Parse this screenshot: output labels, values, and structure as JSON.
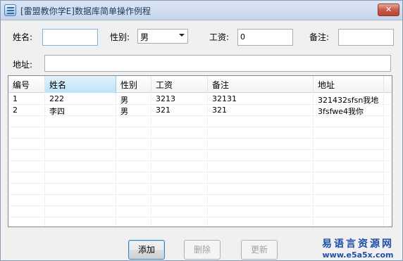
{
  "window": {
    "title": "[雷盟教你学E]数据库简单操作例程",
    "close_glyph": "✕"
  },
  "form": {
    "name_label": "姓名:",
    "name_value": "",
    "gender_label": "性别:",
    "gender_value": "男",
    "salary_label": "工资:",
    "salary_value": "0",
    "note_label": "备注:",
    "note_value": "",
    "address_label": "地址:",
    "address_value": ""
  },
  "table": {
    "columns": [
      "编号",
      "姓名",
      "性别",
      "工资",
      "备注",
      "地址"
    ],
    "rows": [
      [
        "1",
        "222",
        "男",
        "3213",
        "32131",
        "321432sfsn我地"
      ],
      [
        "2",
        "李四",
        "男",
        "321",
        "321",
        "3fsfwe4我你"
      ]
    ]
  },
  "buttons": {
    "add": "添加",
    "delete": "删除",
    "update": "更新"
  },
  "watermark": {
    "name": "易语言资源网",
    "url": "www.e5a5x.com"
  },
  "colors": {
    "accent": "#1f4ea8",
    "close": "#c75a48"
  }
}
